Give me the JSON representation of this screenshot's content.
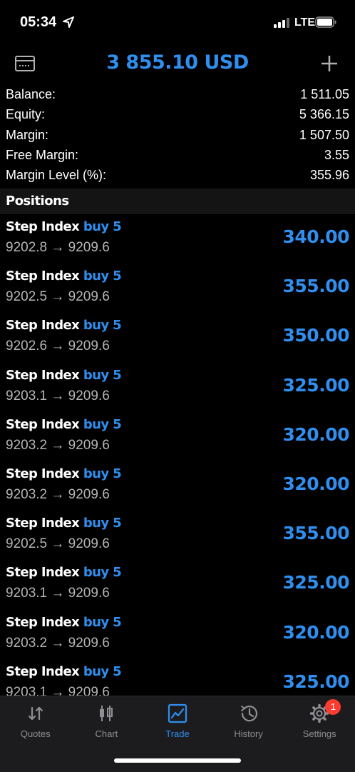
{
  "status_bar": {
    "time": "05:34",
    "network": "LTE",
    "icons": [
      "location-arrow-icon",
      "signal-bars-icon",
      "battery-icon"
    ]
  },
  "header": {
    "title": "3 855.10 USD",
    "left_icon": "wallet-icon",
    "right_icon": "plus-icon"
  },
  "summary": [
    {
      "label": "Balance:",
      "value": "1 511.05"
    },
    {
      "label": "Equity:",
      "value": "5 366.15"
    },
    {
      "label": "Margin:",
      "value": "1 507.50"
    },
    {
      "label": "Free Margin:",
      "value": "3.55"
    },
    {
      "label": "Margin Level (%):",
      "value": "355.96"
    }
  ],
  "positions": {
    "title": "Positions",
    "items": [
      {
        "symbol": "Step Index",
        "side": "buy 5",
        "prices": "9202.8 → 9209.6",
        "profit": "340.00"
      },
      {
        "symbol": "Step Index",
        "side": "buy 5",
        "prices": "9202.5 → 9209.6",
        "profit": "355.00"
      },
      {
        "symbol": "Step Index",
        "side": "buy 5",
        "prices": "9202.6 → 9209.6",
        "profit": "350.00"
      },
      {
        "symbol": "Step Index",
        "side": "buy 5",
        "prices": "9203.1 → 9209.6",
        "profit": "325.00"
      },
      {
        "symbol": "Step Index",
        "side": "buy 5",
        "prices": "9203.2 → 9209.6",
        "profit": "320.00"
      },
      {
        "symbol": "Step Index",
        "side": "buy 5",
        "prices": "9203.2 → 9209.6",
        "profit": "320.00"
      },
      {
        "symbol": "Step Index",
        "side": "buy 5",
        "prices": "9202.5 → 9209.6",
        "profit": "355.00"
      },
      {
        "symbol": "Step Index",
        "side": "buy 5",
        "prices": "9203.1 → 9209.6",
        "profit": "325.00"
      },
      {
        "symbol": "Step Index",
        "side": "buy 5",
        "prices": "9203.2 → 9209.6",
        "profit": "320.00"
      },
      {
        "symbol": "Step Index",
        "side": "buy 5",
        "prices": "9203.1 → 9209.6",
        "profit": "325.00"
      }
    ]
  },
  "tab_bar": {
    "tabs": [
      {
        "label": "Quotes",
        "icon": "quotes-arrows-icon"
      },
      {
        "label": "Chart",
        "icon": "candlestick-chart-icon"
      },
      {
        "label": "Trade",
        "icon": "trade-chart-icon",
        "active": true
      },
      {
        "label": "History",
        "icon": "history-clock-icon"
      },
      {
        "label": "Settings",
        "icon": "settings-gear-icon",
        "badge": "1"
      }
    ]
  },
  "colors": {
    "accent": "#2f8ff0",
    "background": "#000000",
    "tab_bar": "#1c1c1e",
    "inactive": "#8e8e93",
    "badge": "#ff3b30"
  }
}
